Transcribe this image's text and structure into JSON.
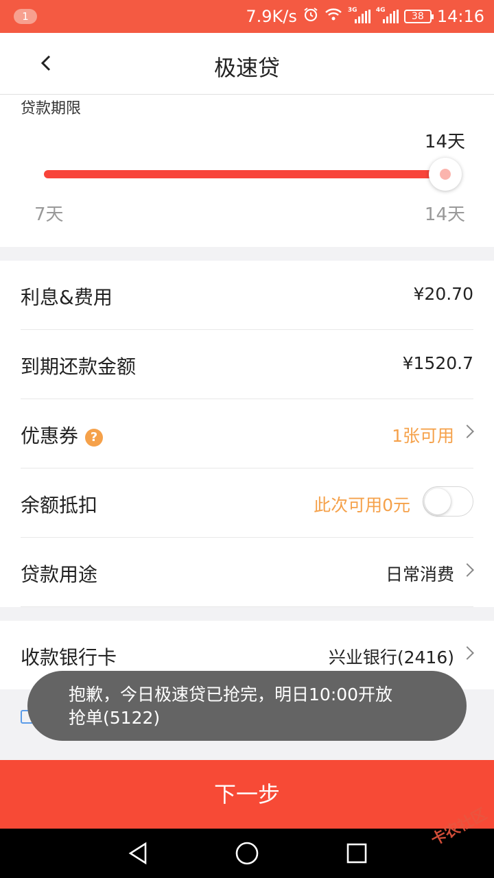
{
  "status_bar": {
    "notification_count": "1",
    "net_speed": "7.9K/s",
    "signal1_label": "3G",
    "signal2_label": "4G",
    "battery": "38",
    "time": "14:16",
    "icons": [
      "alarm-icon",
      "wifi-icon",
      "signal-icon",
      "battery-icon"
    ]
  },
  "header": {
    "title": "极速贷",
    "back_icon": "chevron-left-icon"
  },
  "loan_term": {
    "label": "贷款期限",
    "current_value": "14天",
    "min_label": "7天",
    "max_label": "14天",
    "fill_fraction": 1.0
  },
  "details": {
    "interest": {
      "label": "利息&费用",
      "value": "¥20.70"
    },
    "due_amount": {
      "label": "到期还款金额",
      "value": "¥1520.7"
    },
    "coupon": {
      "label": "优惠券",
      "help_icon": "?",
      "value": "1张可用"
    },
    "balance": {
      "label": "余额抵扣",
      "value": "此次可用0元",
      "toggle_on": false
    },
    "purpose": {
      "label": "贷款用途",
      "value": "日常消费"
    }
  },
  "bank": {
    "label": "收款银行卡",
    "value": "兴业银行(2416)"
  },
  "toast": {
    "line1": "抱歉，今日极速贷已抢完，明日10:00开放",
    "line2": "抢单(5122)"
  },
  "next_button": "下一步",
  "watermark": "卡农社区",
  "colors": {
    "accent": "#f74a36",
    "status_bar": "#f45a42",
    "highlight": "#f5a14a",
    "toast_bg": "#646464"
  }
}
